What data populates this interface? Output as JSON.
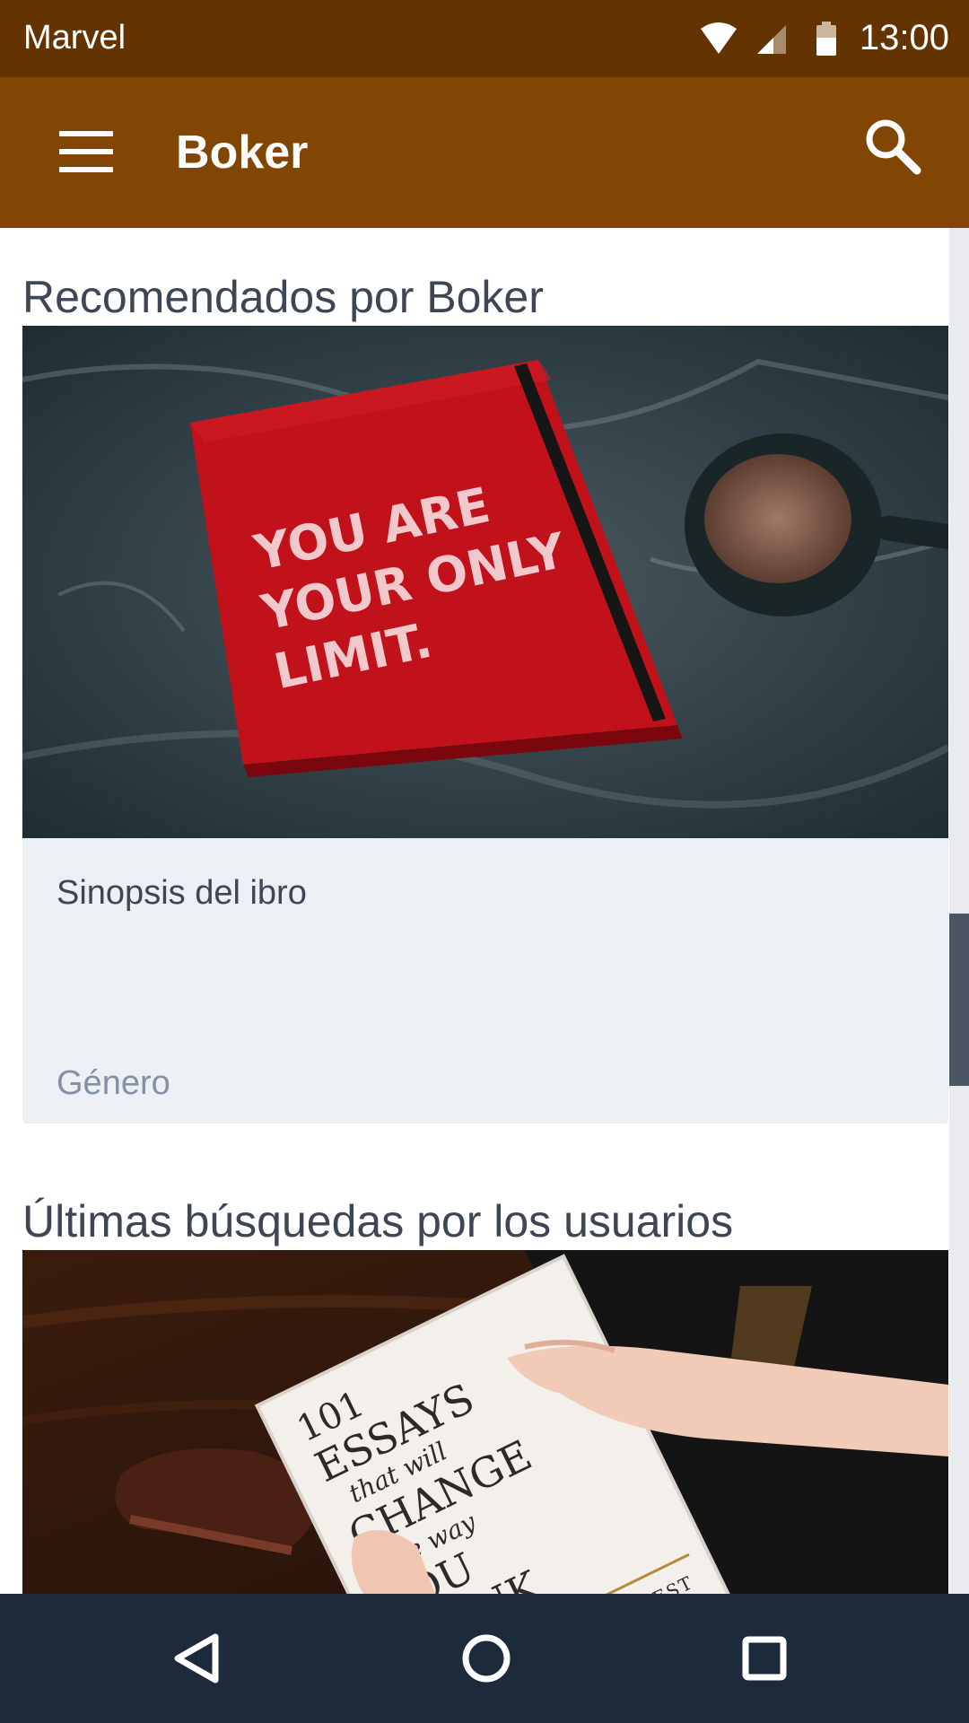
{
  "status_bar": {
    "app_name": "Marvel",
    "time": "13:00",
    "icons": [
      "wifi-icon",
      "signal-icon",
      "battery-icon"
    ]
  },
  "app_bar": {
    "title": "Boker",
    "menu_icon": "hamburger-menu-icon",
    "search_icon": "search-icon"
  },
  "sections": {
    "recommended": {
      "title": "Recomendados por Boker",
      "card": {
        "cover_text": [
          "YOU ARE",
          "YOUR ONLY",
          "LIMIT."
        ],
        "synopsis": "Sinopsis del ibro",
        "genre": "Género"
      }
    },
    "latest": {
      "title": "Últimas búsquedas por los usuarios",
      "card": {
        "cover_text": [
          "101",
          "ESSAYS",
          "that will",
          "CHANGE",
          "the way",
          "YOU",
          "THINK"
        ],
        "author_fragment": "ANNA WIEST"
      }
    }
  },
  "nav_bar": {
    "buttons": [
      "back-icon",
      "home-icon",
      "recents-icon"
    ]
  },
  "colors": {
    "status_bar": "#633400",
    "app_bar": "#824604",
    "nav_bar": "#1d2a3b",
    "card_info_bg": "#eceff4",
    "title_text": "#3d4654",
    "genre_text": "#8390a6"
  }
}
